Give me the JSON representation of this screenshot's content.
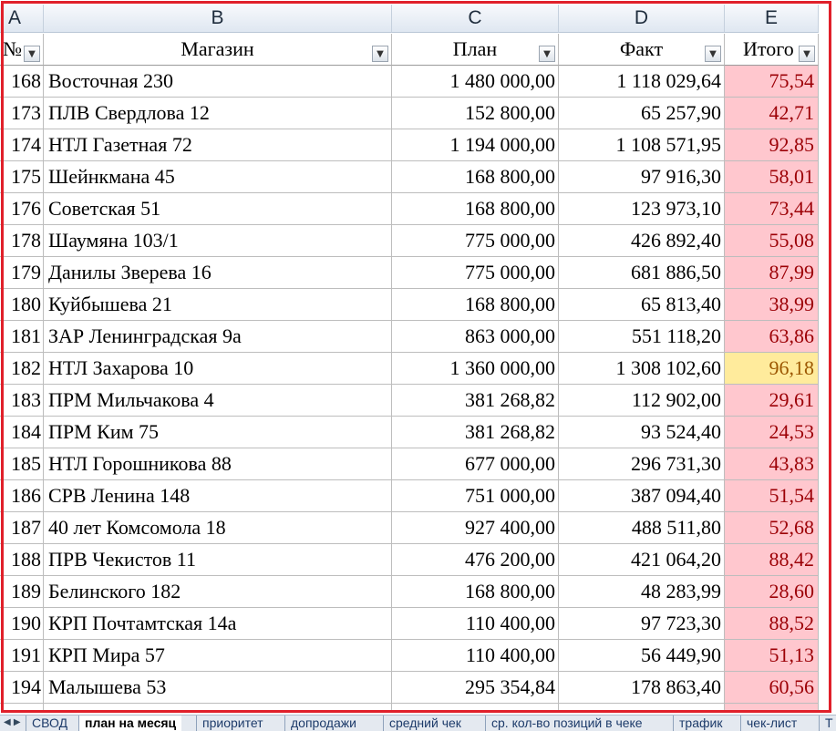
{
  "columns": [
    "A",
    "B",
    "C",
    "D",
    "E"
  ],
  "headers": [
    "№",
    "Магазин",
    "План",
    "Факт",
    "Итого"
  ],
  "rows": [
    {
      "n": "168",
      "shop": "Восточная 230",
      "plan": "1 480 000,00",
      "fact": "1 118 029,64",
      "total": "75,54",
      "hl": "red"
    },
    {
      "n": "173",
      "shop": "ПЛВ Свердлова 12",
      "plan": "152 800,00",
      "fact": "65 257,90",
      "total": "42,71",
      "hl": "red"
    },
    {
      "n": "174",
      "shop": "НТЛ Газетная 72",
      "plan": "1 194 000,00",
      "fact": "1 108 571,95",
      "total": "92,85",
      "hl": "red"
    },
    {
      "n": "175",
      "shop": "Шейнкмана 45",
      "plan": "168 800,00",
      "fact": "97 916,30",
      "total": "58,01",
      "hl": "red"
    },
    {
      "n": "176",
      "shop": "Советская 51",
      "plan": "168 800,00",
      "fact": "123 973,10",
      "total": "73,44",
      "hl": "red"
    },
    {
      "n": "178",
      "shop": "Шаумяна 103/1",
      "plan": "775 000,00",
      "fact": "426 892,40",
      "total": "55,08",
      "hl": "red"
    },
    {
      "n": "179",
      "shop": "Данилы Зверева 16",
      "plan": "775 000,00",
      "fact": "681 886,50",
      "total": "87,99",
      "hl": "red"
    },
    {
      "n": "180",
      "shop": "Куйбышева 21",
      "plan": "168 800,00",
      "fact": "65 813,40",
      "total": "38,99",
      "hl": "red"
    },
    {
      "n": "181",
      "shop": "ЗАР Ленинградская 9а",
      "plan": "863 000,00",
      "fact": "551 118,20",
      "total": "63,86",
      "hl": "red"
    },
    {
      "n": "182",
      "shop": "НТЛ Захарова 10",
      "plan": "1 360 000,00",
      "fact": "1 308 102,60",
      "total": "96,18",
      "hl": "yellow"
    },
    {
      "n": "183",
      "shop": "ПРМ Мильчакова 4",
      "plan": "381 268,82",
      "fact": "112 902,00",
      "total": "29,61",
      "hl": "red"
    },
    {
      "n": "184",
      "shop": "ПРМ Ким 75",
      "plan": "381 268,82",
      "fact": "93 524,40",
      "total": "24,53",
      "hl": "red"
    },
    {
      "n": "185",
      "shop": "НТЛ Горошникова 88",
      "plan": "677 000,00",
      "fact": "296 731,30",
      "total": "43,83",
      "hl": "red"
    },
    {
      "n": "186",
      "shop": "СРВ Ленина 148",
      "plan": "751 000,00",
      "fact": "387 094,40",
      "total": "51,54",
      "hl": "red"
    },
    {
      "n": "187",
      "shop": "40 лет Комсомола 18",
      "plan": "927 400,00",
      "fact": "488 511,80",
      "total": "52,68",
      "hl": "red"
    },
    {
      "n": "188",
      "shop": "ПРВ Чекистов 11",
      "plan": "476 200,00",
      "fact": "421 064,20",
      "total": "88,42",
      "hl": "red"
    },
    {
      "n": "189",
      "shop": "Белинского 182",
      "plan": "168 800,00",
      "fact": "48 283,99",
      "total": "28,60",
      "hl": "red"
    },
    {
      "n": "190",
      "shop": "КРП Почтамтская 14а",
      "plan": "110 400,00",
      "fact": "97 723,30",
      "total": "88,52",
      "hl": "red"
    },
    {
      "n": "191",
      "shop": "КРП Мира 57",
      "plan": "110 400,00",
      "fact": "56 449,90",
      "total": "51,13",
      "hl": "red"
    },
    {
      "n": "194",
      "shop": "Малышева 53",
      "plan": "295 354,84",
      "fact": "178 863,40",
      "total": "60,56",
      "hl": "red"
    }
  ],
  "tabs": [
    "СВОД",
    "план на месяц",
    "приоритет",
    "допродажи",
    "средний чек",
    "ср. кол-во позиций в чеке",
    "трафик",
    "чек-лист",
    "Т"
  ],
  "active_tab": 1,
  "tab_nav": "◀ ▶",
  "colors": {
    "red_fill": "#ffc7ce",
    "red_text": "#9c0006",
    "yellow_fill": "#ffeb9c",
    "yellow_text": "#9c5700",
    "frame": "#e0202a"
  },
  "icons": {
    "filter": "filter-dropdown-icon"
  }
}
